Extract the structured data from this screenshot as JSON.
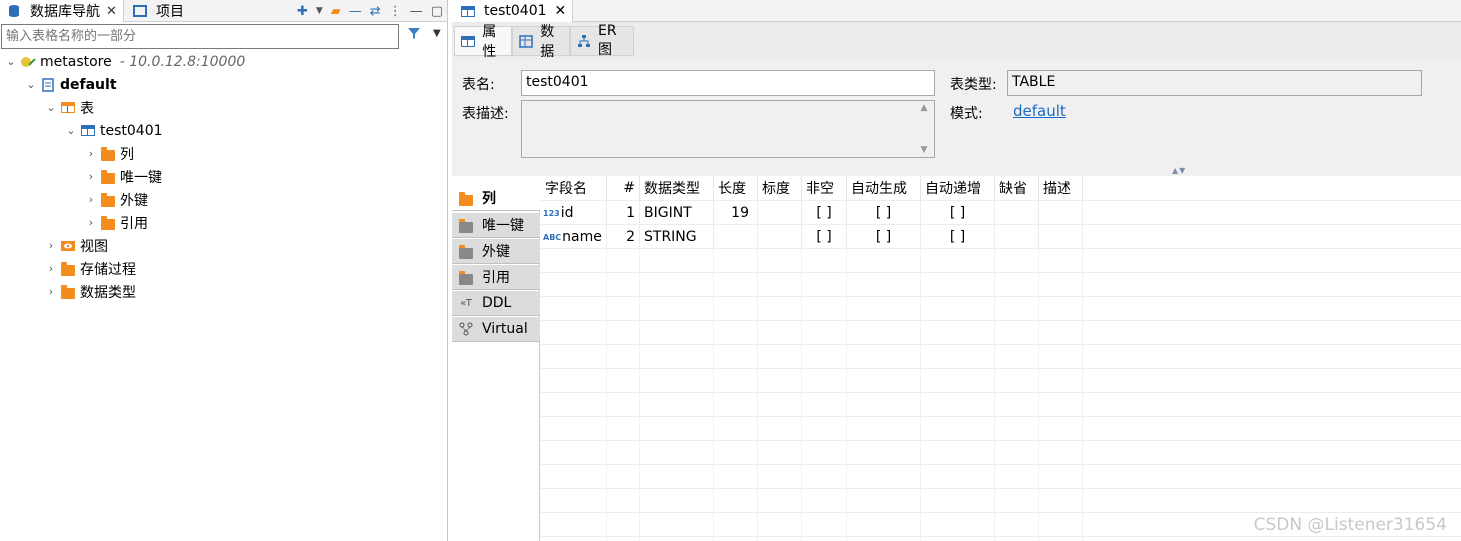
{
  "left_panel": {
    "tabs": [
      {
        "label": "数据库导航",
        "close": "✕"
      },
      {
        "label": "项目"
      }
    ],
    "filter_placeholder": "输入表格名称的一部分",
    "tree": {
      "connection": {
        "label": "metastore",
        "sub": "- 10.0.12.8:10000"
      },
      "database": {
        "label": "default"
      },
      "tables_folder": {
        "label": "表"
      },
      "table": {
        "label": "test0401"
      },
      "table_children": [
        "列",
        "唯一键",
        "外键",
        "引用"
      ],
      "other_folders": [
        "视图",
        "存储过程",
        "数据类型"
      ]
    }
  },
  "editor": {
    "tab": {
      "label": "test0401",
      "close": "✕"
    },
    "subtabs": [
      "属性",
      "数据",
      "ER 图"
    ],
    "props": {
      "table_name_label": "表名:",
      "table_name_value": "test0401",
      "table_type_label": "表类型:",
      "table_type_value": "TABLE",
      "desc_label": "表描述:",
      "schema_label": "模式:",
      "schema_value": "default"
    },
    "vtabs": [
      "列",
      "唯一键",
      "外键",
      "引用",
      "DDL",
      "Virtual"
    ],
    "columns_grid": {
      "headers": [
        "字段名",
        "#",
        "数据类型",
        "长度",
        "标度",
        "非空",
        "自动生成",
        "自动递增",
        "缺省",
        "描述"
      ],
      "rows": [
        {
          "badge": "123",
          "name": "id",
          "num": "1",
          "type": "BIGINT",
          "length": "19",
          "scale": "",
          "notnull": "[ ]",
          "autogen": "[ ]",
          "autoinc": "[ ]",
          "default": "",
          "desc": ""
        },
        {
          "badge": "ABC",
          "name": "name",
          "num": "2",
          "type": "STRING",
          "length": "",
          "scale": "",
          "notnull": "[ ]",
          "autogen": "[ ]",
          "autoinc": "[ ]",
          "default": "",
          "desc": ""
        }
      ]
    }
  },
  "watermark": "CSDN @Listener31654",
  "colors": {
    "accent": "#2e6fb8",
    "folder": "#f28c1d",
    "link": "#1a6bc4"
  }
}
